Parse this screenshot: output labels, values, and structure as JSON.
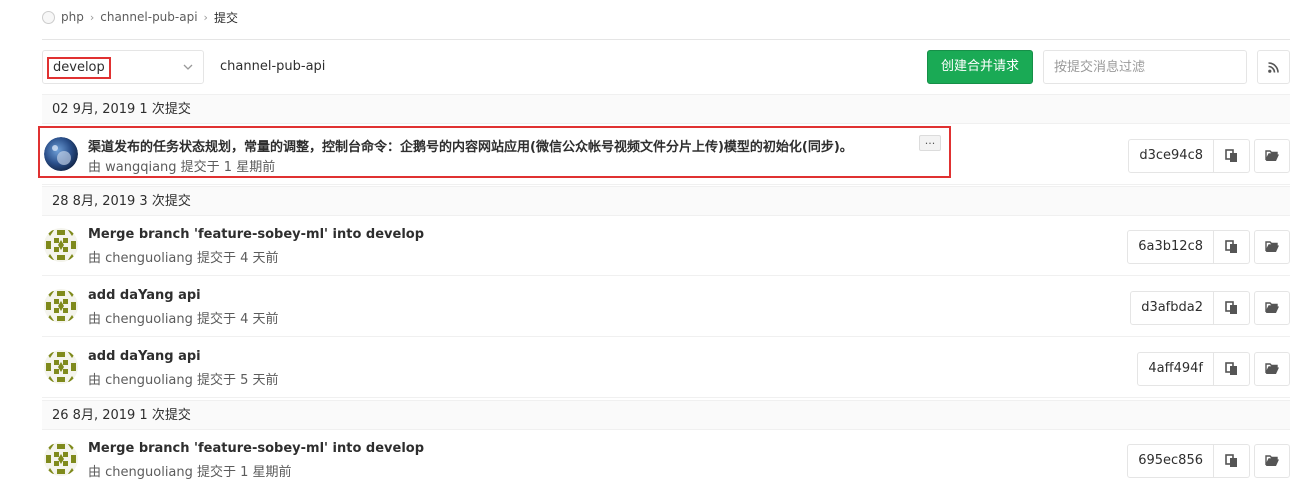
{
  "breadcrumb": {
    "items": [
      "php",
      "channel-pub-api",
      "提交"
    ],
    "separator": "›"
  },
  "toolbar": {
    "branch": "develop",
    "project": "channel-pub-api",
    "create_mr_label": "创建合并请求",
    "filter_placeholder": "按提交消息过滤",
    "rss_icon": "rss-icon"
  },
  "days": [
    {
      "header": "02 9月, 2019 1 次提交",
      "commits": [
        {
          "title": "渠道发布的任务状态规划，常量的调整，控制台命令：企鹅号的内容网站应用(微信公众帐号视频文件分片上传)模型的初始化(同步)。",
          "meta": "由 wangqiang 提交于 1 星期前",
          "sha": "d3ce94c8",
          "avatar": "photo",
          "has_more": true,
          "more_label": "...",
          "highlighted": true
        }
      ]
    },
    {
      "header": "28 8月, 2019 3 次提交",
      "commits": [
        {
          "title": "Merge branch 'feature-sobey-ml' into develop",
          "meta": "由 chenguoliang 提交于 4 天前",
          "sha": "6a3b12c8",
          "avatar": "identicon"
        },
        {
          "title": "add daYang api",
          "meta": "由 chenguoliang 提交于 4 天前",
          "sha": "d3afbda2",
          "avatar": "identicon"
        },
        {
          "title": "add daYang api",
          "meta": "由 chenguoliang 提交于 5 天前",
          "sha": "4aff494f",
          "avatar": "identicon"
        }
      ]
    },
    {
      "header": "26 8月, 2019 1 次提交",
      "commits": [
        {
          "title": "Merge branch 'feature-sobey-ml' into develop",
          "meta": "由 chenguoliang 提交于 1 星期前",
          "sha": "695ec856",
          "avatar": "identicon"
        }
      ]
    }
  ],
  "colors": {
    "accent_green": "#1aaa55",
    "highlight_red": "#e03131",
    "identicon_olive": "#7f8a1c"
  }
}
